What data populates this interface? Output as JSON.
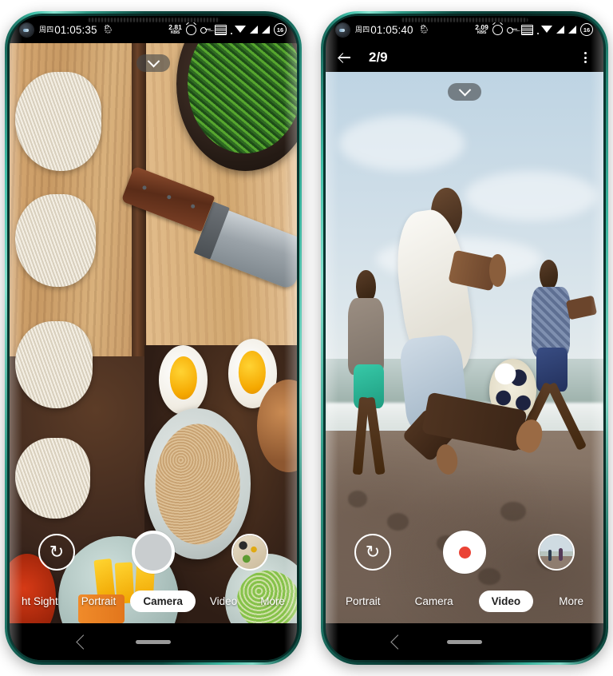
{
  "phones": [
    {
      "id": "left",
      "app": "camera",
      "statusbar": {
        "day_of_week": "周四",
        "time": "01:05:35",
        "weather_icon": "weather-emoji",
        "netspeed_value": "2.81",
        "netspeed_unit": "KB/S",
        "icons": [
          "alarm-icon",
          "key-icon",
          "volte-icon",
          "wifi-icon",
          "signal-icon",
          "signal-icon"
        ],
        "battery": "16"
      },
      "viewfinder": {
        "expand_icon": "chevron-down-icon",
        "scene": "food-flatlay"
      },
      "controls": {
        "flip_icon": "camera-flip-icon",
        "shutter_type": "photo",
        "thumbnail": "spice-bowls-thumbnail"
      },
      "modes": [
        {
          "label": "ht Sight",
          "active": false
        },
        {
          "label": "Portrait",
          "active": false
        },
        {
          "label": "Camera",
          "active": true
        },
        {
          "label": "Video",
          "active": false
        },
        {
          "label": "More",
          "active": false
        }
      ],
      "navbar": {
        "back_icon": "nav-back-icon",
        "home_icon": "nav-home-pill"
      }
    },
    {
      "id": "right",
      "app": "gallery-video",
      "statusbar": {
        "day_of_week": "周四",
        "time": "01:05:40",
        "weather_icon": "weather-emoji",
        "netspeed_value": "2.09",
        "netspeed_unit": "KB/S",
        "icons": [
          "alarm-icon",
          "key-icon",
          "volte-icon",
          "wifi-icon",
          "signal-icon",
          "signal-icon"
        ],
        "battery": "16"
      },
      "header": {
        "back_icon": "back-arrow-icon",
        "title": "2/9",
        "menu_icon": "kebab-menu-icon"
      },
      "viewfinder": {
        "expand_icon": "chevron-down-icon",
        "scene": "beach-soccer"
      },
      "controls": {
        "flip_icon": "camera-flip-icon",
        "shutter_type": "video",
        "thumbnail": "beach-walkers-thumbnail"
      },
      "modes": [
        {
          "label": "Portrait",
          "active": false
        },
        {
          "label": "Camera",
          "active": false
        },
        {
          "label": "Video",
          "active": true
        },
        {
          "label": "More",
          "active": false
        }
      ],
      "navbar": {
        "back_icon": "nav-back-icon",
        "home_icon": "nav-home-pill"
      }
    }
  ],
  "colors": {
    "frame_teal": "#2e9a86",
    "record_red": "#ea4335",
    "active_pill": "#ffffff",
    "statusbar_bg": "#000000"
  },
  "glyphs": {
    "flip": "↻",
    "weather": "🌦"
  }
}
